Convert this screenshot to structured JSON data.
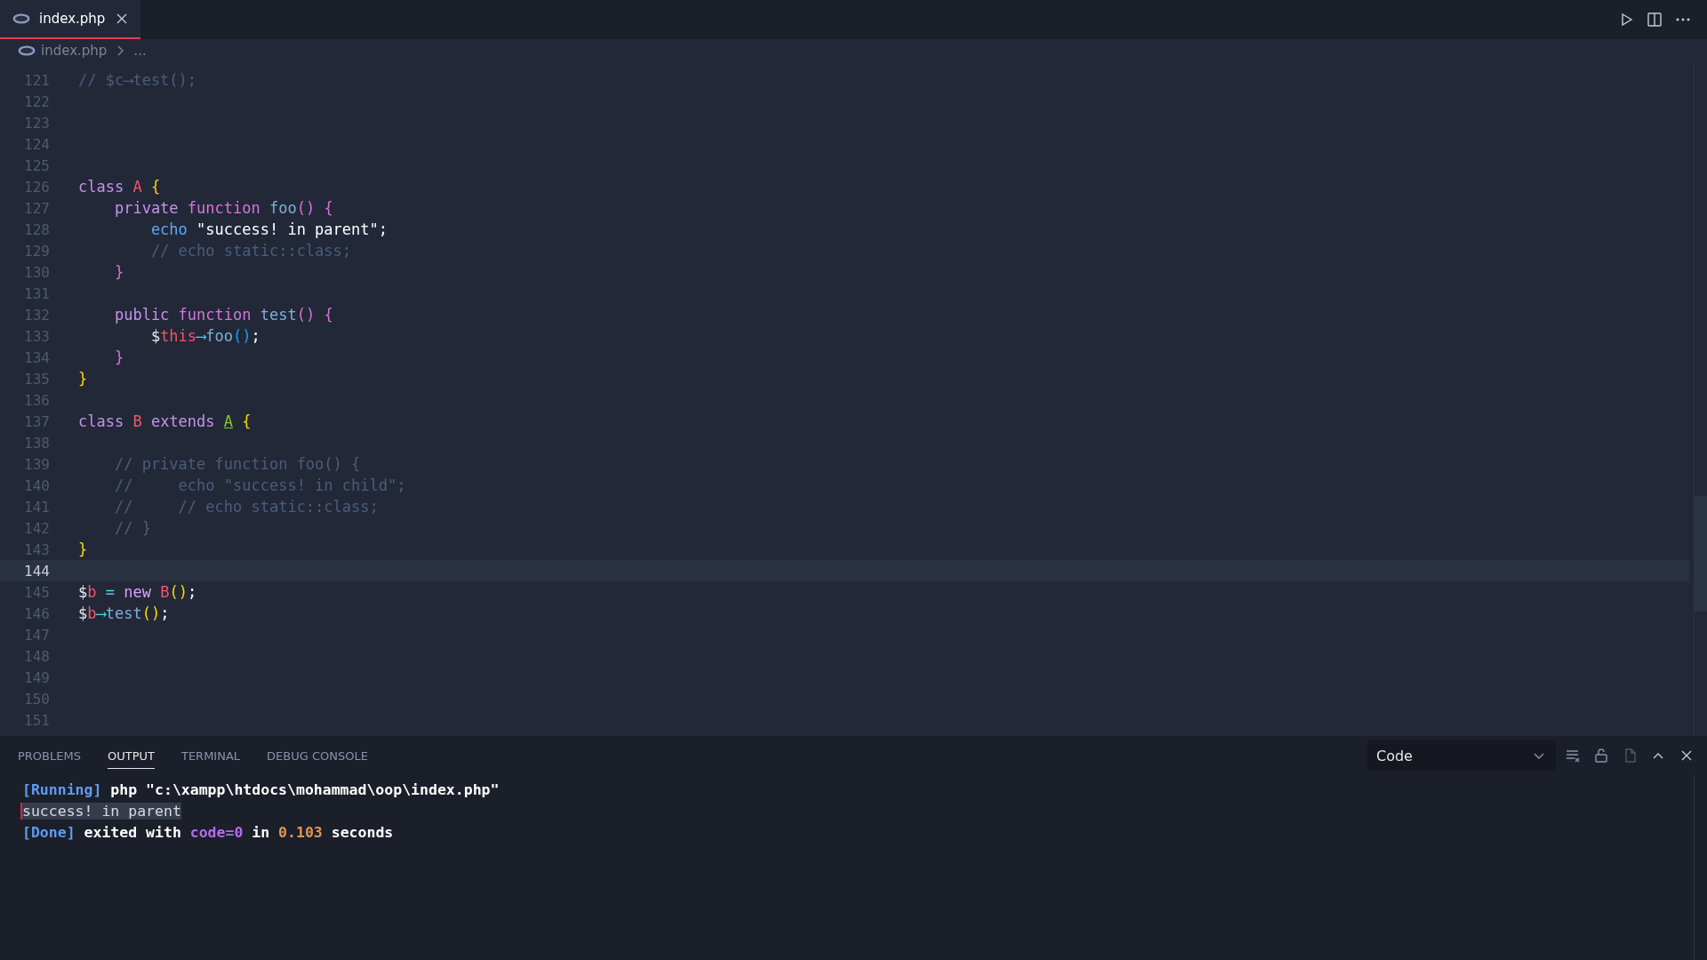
{
  "tabs": [
    {
      "label": "index.php",
      "selected": true
    }
  ],
  "breadcrumb": {
    "file": "index.php",
    "rest": "..."
  },
  "editor": {
    "lines": [
      {
        "number": "121",
        "current": false,
        "tokens": [
          {
            "kind": "cmt",
            "text": "// $c⟶test();"
          }
        ]
      },
      {
        "number": "122",
        "current": false
      },
      {
        "number": "123",
        "current": false
      },
      {
        "number": "124",
        "current": false
      },
      {
        "number": "125",
        "current": false
      },
      {
        "number": "126",
        "current": false,
        "tokens": [
          {
            "kind": "kw",
            "text": "class"
          },
          {
            "kind": "cls",
            "text": " A"
          },
          {
            "kind": "brace1",
            "text": " {"
          }
        ]
      },
      {
        "number": "127",
        "current": false,
        "tokens": [
          {
            "kind": "kw",
            "text": "    private"
          },
          {
            "kind": "kw2",
            "text": " function"
          },
          {
            "kind": "fn",
            "text": " foo"
          },
          {
            "kind": "brace2",
            "text": "() {"
          }
        ]
      },
      {
        "number": "128",
        "current": false,
        "tokens": [
          {
            "kind": "echo",
            "text": "        echo"
          },
          {
            "kind": "str",
            "text": " \"success! in parent\";"
          }
        ]
      },
      {
        "number": "129",
        "current": false,
        "tokens": [
          {
            "kind": "cmt",
            "text": "        // echo static::class;"
          }
        ]
      },
      {
        "number": "130",
        "current": false,
        "tokens": [
          {
            "kind": "brace2",
            "text": "    }"
          }
        ]
      },
      {
        "number": "131",
        "current": false
      },
      {
        "number": "132",
        "current": false,
        "tokens": [
          {
            "kind": "kw",
            "text": "    public"
          },
          {
            "kind": "kw2",
            "text": " function"
          },
          {
            "kind": "fn",
            "text": " test"
          },
          {
            "kind": "brace2",
            "text": "() {"
          }
        ]
      },
      {
        "number": "133",
        "current": false,
        "tokens": [
          {
            "kind": "var",
            "text": "        $"
          },
          {
            "kind": "cls",
            "text": "this"
          },
          {
            "kind": "op",
            "text": "⟶"
          },
          {
            "kind": "fn",
            "text": "foo"
          },
          {
            "kind": "brace3",
            "text": "()"
          },
          {
            "kind": "str",
            "text": ";"
          }
        ]
      },
      {
        "number": "134",
        "current": false,
        "tokens": [
          {
            "kind": "brace2",
            "text": "    }"
          }
        ]
      },
      {
        "number": "135",
        "current": false,
        "tokens": [
          {
            "kind": "brace1",
            "text": "}"
          }
        ]
      },
      {
        "number": "136",
        "current": false
      },
      {
        "number": "137",
        "current": false,
        "tokens": [
          {
            "kind": "kw",
            "text": "class"
          },
          {
            "kind": "cls",
            "text": " B"
          },
          {
            "kind": "kw",
            "text": " extends "
          },
          {
            "kind": "parent",
            "text": "A"
          },
          {
            "kind": "brace1",
            "text": " {"
          }
        ]
      },
      {
        "number": "138",
        "current": false
      },
      {
        "number": "139",
        "current": false,
        "tokens": [
          {
            "kind": "cmt",
            "text": "    // private function foo() {"
          }
        ]
      },
      {
        "number": "140",
        "current": false,
        "tokens": [
          {
            "kind": "cmt",
            "text": "    //     echo \"success! in child\";"
          }
        ]
      },
      {
        "number": "141",
        "current": false,
        "tokens": [
          {
            "kind": "cmt",
            "text": "    //     // echo static::class;"
          }
        ]
      },
      {
        "number": "142",
        "current": false,
        "tokens": [
          {
            "kind": "cmt",
            "text": "    // }"
          }
        ]
      },
      {
        "number": "143",
        "current": false,
        "tokens": [
          {
            "kind": "brace1",
            "text": "}"
          }
        ]
      },
      {
        "number": "144",
        "current": true
      },
      {
        "number": "145",
        "current": false,
        "tokens": [
          {
            "kind": "var",
            "text": "$"
          },
          {
            "kind": "cls",
            "text": "b"
          },
          {
            "kind": "op",
            "text": " = "
          },
          {
            "kind": "newkw",
            "text": "new"
          },
          {
            "kind": "cls",
            "text": " B"
          },
          {
            "kind": "brace1",
            "text": "()"
          },
          {
            "kind": "str",
            "text": ";"
          }
        ]
      },
      {
        "number": "146",
        "current": false,
        "tokens": [
          {
            "kind": "var",
            "text": "$"
          },
          {
            "kind": "cls",
            "text": "b"
          },
          {
            "kind": "op",
            "text": "⟶"
          },
          {
            "kind": "fn",
            "text": "test"
          },
          {
            "kind": "brace1",
            "text": "()"
          },
          {
            "kind": "str",
            "text": ";"
          }
        ]
      },
      {
        "number": "147",
        "current": false
      },
      {
        "number": "148",
        "current": false
      },
      {
        "number": "149",
        "current": false
      },
      {
        "number": "150",
        "current": false
      },
      {
        "number": "151",
        "current": false
      }
    ]
  },
  "panel": {
    "tabs": [
      {
        "label": "PROBLEMS",
        "selected": false
      },
      {
        "label": "OUTPUT",
        "selected": true
      },
      {
        "label": "TERMINAL",
        "selected": false
      },
      {
        "label": "DEBUG CONSOLE",
        "selected": false
      }
    ],
    "channel": "Code",
    "output": [
      {
        "selected": false,
        "tokens": [
          {
            "kind": "tag",
            "text": "[Running]"
          },
          {
            "kind": "plain",
            "text": " php \"c:\\xampp\\htdocs\\mohammad\\oop\\index.php\""
          }
        ]
      },
      {
        "selected": true,
        "tokens": [
          {
            "kind": "plain",
            "text": "success! in parent"
          }
        ]
      },
      {
        "selected": false,
        "tokens": [
          {
            "kind": "tag",
            "text": "[Done]"
          },
          {
            "kind": "plain",
            "text": " exited with "
          },
          {
            "kind": "code",
            "text": "code=0"
          },
          {
            "kind": "plain",
            "text": " in "
          },
          {
            "kind": "num",
            "text": "0.103"
          },
          {
            "kind": "plain",
            "text": " seconds"
          }
        ]
      }
    ]
  }
}
